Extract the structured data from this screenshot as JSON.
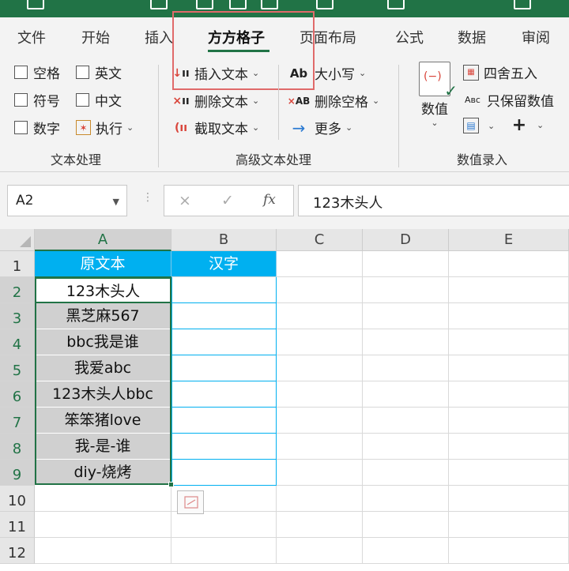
{
  "ribbon": {
    "tabs": [
      "文件",
      "开始",
      "插入",
      "方方格子",
      "页面布局",
      "公式",
      "数据",
      "审阅"
    ],
    "active_tab": "方方格子",
    "text_group": {
      "label": "文本处理",
      "options": [
        "空格",
        "英文",
        "符号",
        "中文",
        "数字"
      ],
      "execute": "执行"
    },
    "advanced_group": {
      "label": "高级文本处理",
      "insert_text": "插入文本",
      "delete_text": "删除文本",
      "extract_text": "截取文本",
      "case": "大小写",
      "delete_spaces": "删除空格",
      "more": "更多"
    },
    "numeric_group": {
      "label": "数值录入",
      "numeric": "数值",
      "round": "四舍五入",
      "keep_value": "只保留数值"
    }
  },
  "formula_bar": {
    "name_box": "A2",
    "cancel": "×",
    "confirm": "✓",
    "fx": "fx",
    "content": "123木头人"
  },
  "sheet": {
    "columns": [
      "A",
      "B",
      "C",
      "D",
      "E"
    ],
    "rows": [
      "1",
      "2",
      "3",
      "4",
      "5",
      "6",
      "7",
      "8",
      "9",
      "10",
      "11",
      "12"
    ],
    "header_a": "原文本",
    "header_b": "汉字",
    "col_a": [
      "123木头人",
      "黑芝麻567",
      "bbc我是谁",
      "我爱abc",
      "123木头人bbc",
      "笨笨猪love",
      "我-是-谁",
      "diy-烧烤"
    ],
    "active_cell": "A2",
    "header_color": "#00b0f0",
    "accent_color": "#217346"
  }
}
